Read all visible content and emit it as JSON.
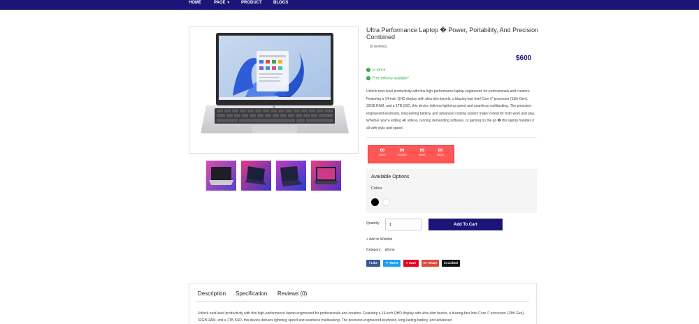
{
  "nav": {
    "items": [
      "HOME",
      "PAGE",
      "PRODUCT",
      "BLOGS"
    ]
  },
  "product": {
    "title": "Ultra Performance Laptop � Power, Portability, And Precision Combined",
    "reviews": "(0 reviews)",
    "price": "$600",
    "in_stock": "In Stock",
    "delivery": "Free delivery available*",
    "description": "Unlock next-level productivity with this high-performance laptop engineered for professionals and creators. Featuring a 14-inch QHD display with ultra-slim bezels, a blazing-fast Intel Core i7 processor (13th Gen), 32GB RAM, and a 1TB SSD, this device delivers lightning speed and seamless multitasking. The precision-engineered keyboard, long-lasting battery, and advanced cooling system make it ideal for both work and play. Whether you're editing 4K videos, running demanding software, or gaming on the go � this laptop handles it all with style and speed."
  },
  "countdown": {
    "days": "00",
    "days_label": "DAYS",
    "hours": "00",
    "hours_label": "HOURS",
    "mins": "00",
    "mins_label": "MINS",
    "secs": "00",
    "secs_label": "SECS"
  },
  "options": {
    "title": "Available Options",
    "colors_label": "Colors",
    "colors": [
      "#000000",
      "#ffffff"
    ]
  },
  "purchase": {
    "quantity_label": "Quantity",
    "quantity_value": "1",
    "add_to_cart": "Add To Cart",
    "wishlist": "+ Add to Wishlist",
    "category_label": "Category:",
    "category_value": "phone"
  },
  "share": {
    "like": "f Like",
    "tweet": "Tweet",
    "save": "Save",
    "gshare": "G+ Share",
    "linkedin": "in Linked"
  },
  "tabs": {
    "description": "Description",
    "specification": "Specification",
    "reviews": "Reviews (0)",
    "body": "Unlock next-level productivity with this high-performance laptop engineered for professionals and creators. Featuring a 14-inch QHD display with ultra-slim bezels, a blazing-fast Intel Core i7 processor (13th Gen), 32GB RAM, and a 1TB SSD, this device delivers lightning speed and seamless multitasking. The precision-engineered keyboard, long-lasting battery, and advanced"
  },
  "colors": {
    "nav_bg": "#1b1577",
    "accent": "#1b1577",
    "countdown_bg": "#ff5656",
    "stock_green": "#27a844"
  }
}
